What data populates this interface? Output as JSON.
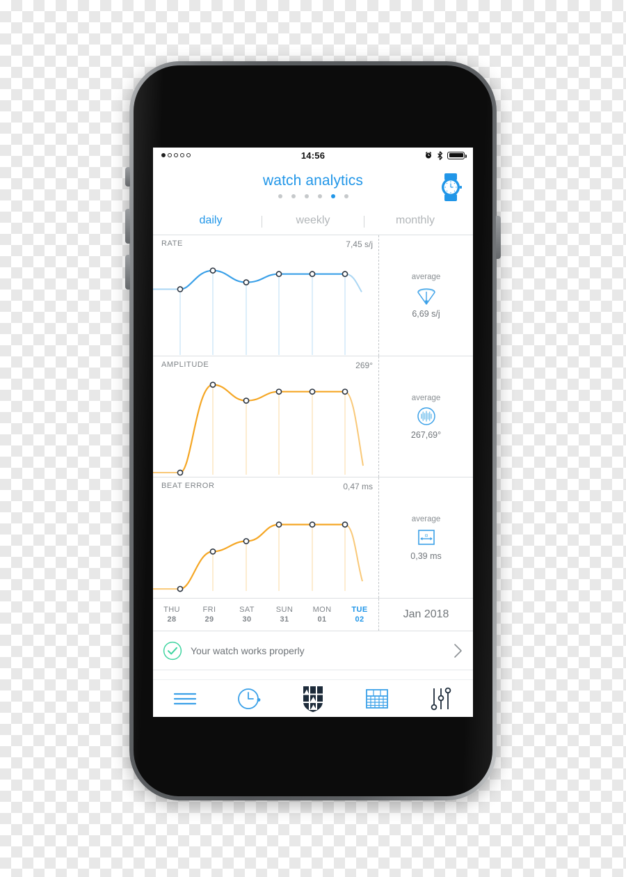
{
  "status_bar": {
    "time": "14:56",
    "signal_dots": [
      true,
      false,
      false,
      false,
      false
    ],
    "alarm_icon": "alarm-clock-icon",
    "bluetooth_icon": "bluetooth-icon",
    "battery_icon": "battery-full-icon"
  },
  "header": {
    "title": "watch analytics",
    "watch_icon": "wristwatch-icon",
    "page_dots_count": 6,
    "page_dots_active_index": 4
  },
  "tabs": {
    "items": [
      {
        "label": "daily",
        "active": true
      },
      {
        "label": "weekly",
        "active": false
      },
      {
        "label": "monthly",
        "active": false
      }
    ]
  },
  "colors": {
    "accent_blue": "#2196e8",
    "rate_line": "#3aa0e8",
    "amplitude_line": "#f5a623",
    "beat_error_line": "#f5a623",
    "grey_text": "#7d8286",
    "success_green": "#3fd4a0"
  },
  "days": [
    {
      "name": "THU",
      "num": "28",
      "active": false
    },
    {
      "name": "FRI",
      "num": "29",
      "active": false
    },
    {
      "name": "SAT",
      "num": "30",
      "active": false
    },
    {
      "name": "SUN",
      "num": "31",
      "active": false
    },
    {
      "name": "MON",
      "num": "01",
      "active": false
    },
    {
      "name": "TUE",
      "num": "02",
      "active": true
    }
  ],
  "month_label": "Jan 2018",
  "health_status": {
    "text": "Your watch works properly",
    "icon": "check-circle-icon",
    "chevron": "chevron-right-icon"
  },
  "tab_bar": {
    "items": [
      {
        "name": "menu-icon",
        "label": "menu"
      },
      {
        "name": "clock-icon",
        "label": "timegrapher"
      },
      {
        "name": "crest-icon",
        "label": "brand"
      },
      {
        "name": "calendar-icon",
        "label": "calendar"
      },
      {
        "name": "sliders-icon",
        "label": "settings"
      }
    ]
  },
  "chart_data": [
    {
      "type": "line",
      "title": "RATE",
      "value_label": "7,45 s/j",
      "unit": "s/j",
      "average_label": "average",
      "average_value": "6,69 s/j",
      "average_icon": "beat-fan-icon",
      "categories": [
        "THU 28",
        "FRI 29",
        "SAT 30",
        "SUN 31",
        "MON 01",
        "TUE 02"
      ],
      "values": [
        5.3,
        7.45,
        6.2,
        7.1,
        7.1,
        7.1
      ],
      "ylim": [
        0,
        8.2
      ],
      "xlabel": "",
      "ylabel": "s/j",
      "grid": false,
      "legend": "none",
      "color": "#3aa0e8"
    },
    {
      "type": "line",
      "title": "AMPLITUDE",
      "value_label": "269°",
      "unit": "°",
      "average_label": "average",
      "average_value": "267,69°",
      "average_icon": "amplitude-circle-icon",
      "categories": [
        "THU 28",
        "FRI 29",
        "SAT 30",
        "SUN 31",
        "MON 01",
        "TUE 02"
      ],
      "values": [
        0,
        269,
        255,
        263,
        263,
        263
      ],
      "ylim": [
        0,
        278
      ],
      "xlabel": "",
      "ylabel": "degrees",
      "grid": false,
      "legend": "none",
      "color": "#f5a623"
    },
    {
      "type": "line",
      "title": "BEAT ERROR",
      "value_label": "0,47 ms",
      "unit": "ms",
      "average_label": "average",
      "average_value": "0,39 ms",
      "average_icon": "beat-error-box-icon",
      "categories": [
        "THU 28",
        "FRI 29",
        "SAT 30",
        "SUN 31",
        "MON 01",
        "TUE 02"
      ],
      "values": [
        0.0,
        0.27,
        0.33,
        0.47,
        0.47,
        0.47
      ],
      "ylim": [
        0,
        0.52
      ],
      "xlabel": "",
      "ylabel": "ms",
      "grid": false,
      "legend": "none",
      "color": "#f5a623"
    }
  ]
}
